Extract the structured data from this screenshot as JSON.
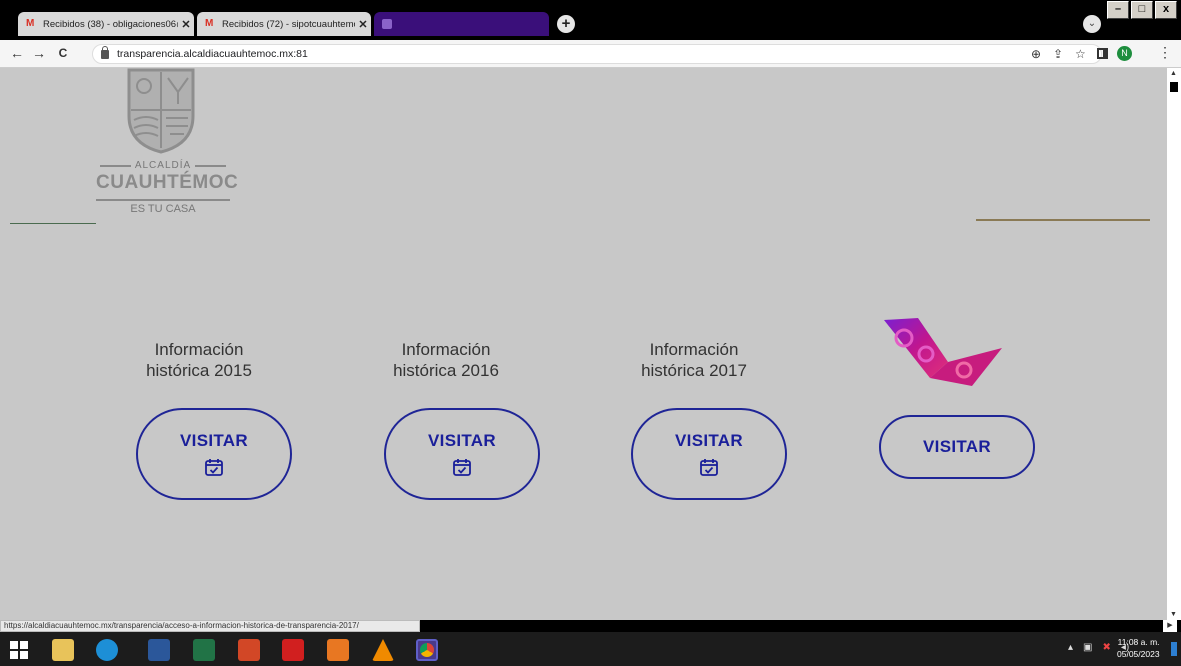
{
  "browser": {
    "tabs": [
      {
        "title": "Recibidos (38) - obligaciones06@",
        "icon": "gmail-icon"
      },
      {
        "title": "Recibidos (72) - sipotcuauhtemoc",
        "icon": "gmail-icon"
      },
      {
        "title": "",
        "icon": "site-favicon"
      }
    ],
    "new_tab_label": "+",
    "window_buttons": {
      "minimize": "–",
      "maximize": "□",
      "close": "x"
    },
    "nav": {
      "back": "←",
      "forward": "→",
      "reload": "C"
    },
    "url": "transparencia.alcaldiacuauhtemoc.mx:81",
    "avatar_letter": "N",
    "status_url": "https://alcaldiacuauhtemoc.mx/transparencia/acceso-a-informacion-historica-de-transparencia-2017/"
  },
  "page": {
    "logo": {
      "small": "ALCALDÍA",
      "big": "CUAUHTÉMOC",
      "tagline": "ES TU CASA"
    },
    "cards": [
      {
        "title_line1": "Información",
        "title_line2": "histórica 2015",
        "button": "VISITAR"
      },
      {
        "title_line1": "Información",
        "title_line2": "histórica 2016",
        "button": "VISITAR"
      },
      {
        "title_line1": "Información",
        "title_line2": "histórica 2017",
        "button": "VISITAR"
      },
      {
        "title_line1": "",
        "title_line2": "",
        "button": "VISITAR"
      }
    ],
    "colors": {
      "background": "#c8c8c8",
      "button_border": "#1f2596",
      "button_text": "#1a1f9a"
    }
  },
  "taskbar": {
    "clock_time": "11:08 a. m.",
    "clock_date": "05/05/2023",
    "apps": [
      "windows-start-icon",
      "file-explorer-icon",
      "edge-icon",
      "word-icon",
      "excel-icon",
      "powerpoint-icon",
      "acrobat-icon",
      "nitro-icon",
      "vlc-icon",
      "chrome-icon"
    ]
  }
}
